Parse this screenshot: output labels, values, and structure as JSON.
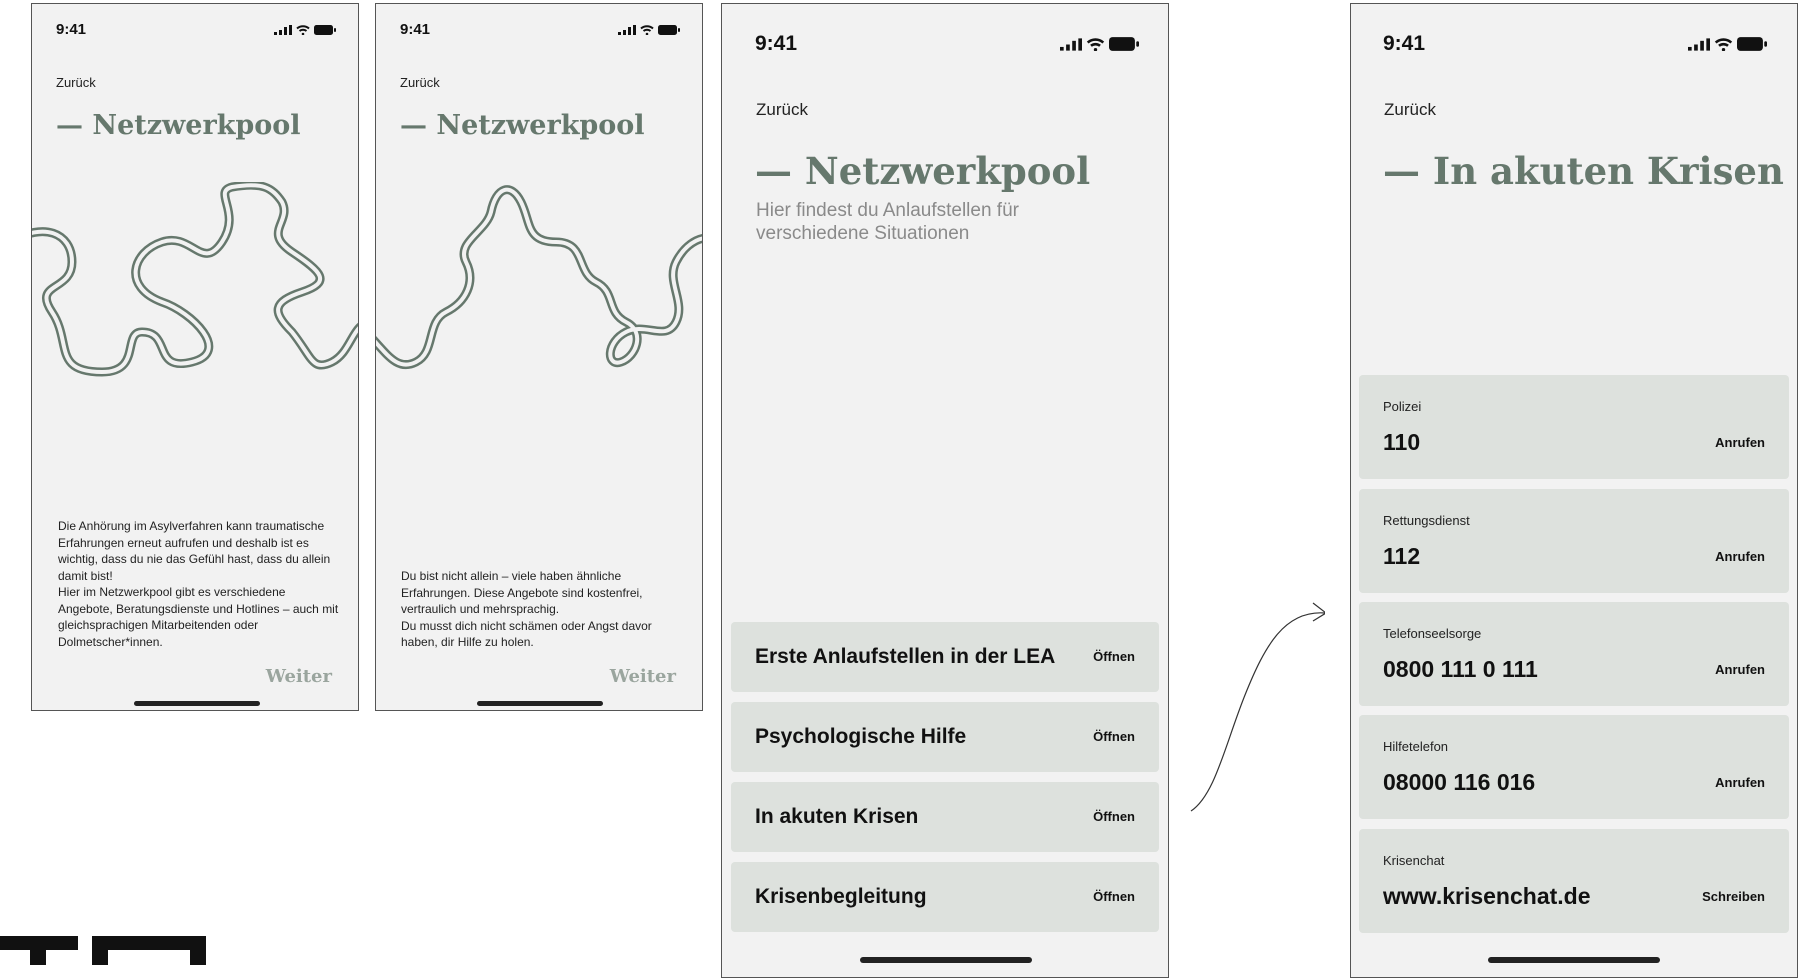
{
  "status": {
    "time": "9:41"
  },
  "screen1": {
    "back": "Zurück",
    "title": "— Netzwerkpool",
    "body": "Die Anhörung im Asylverfahren kann traumatische Erfahrungen erneut aufrufen und deshalb ist es wichtig, dass du nie das Gefühl hast, dass du allein damit bist!\nHier im Netzwerkpool gibt es verschiedene Angebote, Beratungsdienste und Hotlines – auch mit gleichsprachigen Mitarbeitenden oder Dolmetscher*innen.",
    "next": "Weiter"
  },
  "screen2": {
    "back": "Zurück",
    "title": "— Netzwerkpool",
    "body": "Du bist nicht allein – viele haben ähnliche Erfahrungen. Diese Angebote sind kostenfrei, vertraulich und mehrsprachig.\nDu musst dich nicht schämen oder Angst davor haben, dir Hilfe zu holen.",
    "next": "Weiter"
  },
  "screen3": {
    "back": "Zurück",
    "title": "— Netzwerkpool",
    "subtitle": "Hier findest du Anlaufstellen für verschiedene Situationen",
    "items": [
      {
        "label": "Erste Anlaufstellen in der LEA",
        "action": "Öffnen"
      },
      {
        "label": "Psychologische Hilfe",
        "action": "Öffnen"
      },
      {
        "label": "In akuten Krisen",
        "action": "Öffnen"
      },
      {
        "label": "Krisenbegleitung",
        "action": "Öffnen"
      }
    ]
  },
  "screen4": {
    "back": "Zurück",
    "title": "— In akuten Krisen",
    "contacts": [
      {
        "name": "Polizei",
        "number": "110",
        "action": "Anrufen"
      },
      {
        "name": "Rettungsdienst",
        "number": "112",
        "action": "Anrufen"
      },
      {
        "name": "Telefonseelsorge",
        "number": "0800 111 0 111",
        "action": "Anrufen"
      },
      {
        "name": "Hilfetelefon",
        "number": "08000 116 016",
        "action": "Anrufen"
      },
      {
        "name": "Krisenchat",
        "number": "www.krisenchat.de",
        "action": "Schreiben"
      }
    ]
  },
  "icons": [
    "signal-icon",
    "wifi-icon",
    "battery-icon",
    "arrow-icon",
    "logo-mark"
  ],
  "colors": {
    "accent": "#66786d",
    "card": "#dde1dd",
    "background": "#f2f2f2",
    "weiter": "#9aa59e"
  }
}
